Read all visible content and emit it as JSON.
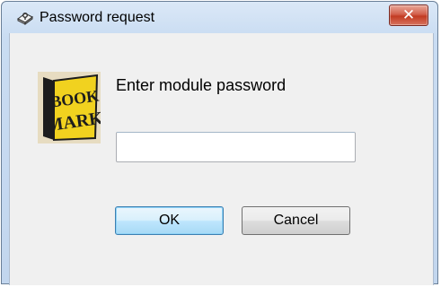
{
  "window": {
    "title": "Password request",
    "title_icon": "key-lock-icon",
    "close_icon": "close-icon",
    "close_label": "✕"
  },
  "dialog": {
    "logo_text_top": "BOOK",
    "logo_text_bottom": "MARK",
    "prompt": "Enter module password",
    "password_value": "",
    "ok_label": "OK",
    "cancel_label": "Cancel"
  },
  "colors": {
    "title_bar": "#c9dcf2",
    "client_bg": "#f0f0f0",
    "close_button": "#c23b22",
    "default_button_border": "#3c7fb1"
  }
}
